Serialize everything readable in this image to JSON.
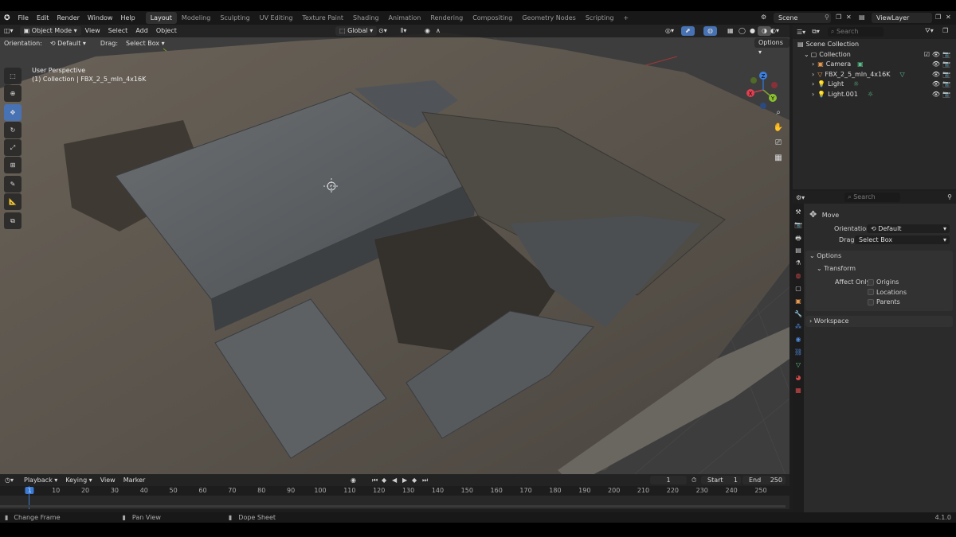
{
  "menu": {
    "items": [
      "File",
      "Edit",
      "Render",
      "Window",
      "Help"
    ]
  },
  "workspaces": [
    "Layout",
    "Modeling",
    "Sculpting",
    "UV Editing",
    "Texture Paint",
    "Shading",
    "Animation",
    "Rendering",
    "Compositing",
    "Geometry Nodes",
    "Scripting"
  ],
  "active_workspace": "Layout",
  "scene": {
    "label": "Scene"
  },
  "view_layer": {
    "label": "ViewLayer"
  },
  "viewport": {
    "mode": "Object Mode",
    "menus": [
      "View",
      "Select",
      "Add",
      "Object"
    ],
    "transform_orientation": "Global",
    "orientation_label": "Orientation:",
    "orientation_value": "Default",
    "drag_label": "Drag:",
    "drag_value": "Select Box",
    "options_label": "Options",
    "perspective": "User Perspective",
    "collection_info": "(1) Collection | FBX_2_5_mln_4x16K",
    "axes": [
      "X",
      "Y",
      "Z"
    ]
  },
  "outliner": {
    "search_placeholder": "Search",
    "root": "Scene Collection",
    "collection": "Collection",
    "items": [
      {
        "name": "Camera",
        "icon": "camera-icon"
      },
      {
        "name": "FBX_2_5_mln_4x16K",
        "icon": "mesh-icon"
      },
      {
        "name": "Light",
        "icon": "light-icon"
      },
      {
        "name": "Light.001",
        "icon": "light-icon"
      }
    ]
  },
  "properties": {
    "search_placeholder": "Search",
    "tool_name": "Move",
    "orientation_label": "Orientation",
    "orientation_value": "Default",
    "drag_label": "Drag:",
    "drag_value": "Select Box",
    "options_panel": "Options",
    "transform_subpanel": "Transform",
    "affect_only_label": "Affect Only",
    "affect_only": [
      "Origins",
      "Locations",
      "Parents"
    ],
    "workspace_panel": "Workspace"
  },
  "timeline": {
    "menus": [
      "Playback",
      "Keying",
      "View",
      "Marker"
    ],
    "current_frame": "1",
    "start_label": "Start",
    "start": "1",
    "end_label": "End",
    "end": "250",
    "ticks": [
      "1",
      "10",
      "20",
      "30",
      "40",
      "50",
      "60",
      "70",
      "80",
      "90",
      "100",
      "110",
      "120",
      "130",
      "140",
      "150",
      "160",
      "170",
      "180",
      "190",
      "200",
      "210",
      "220",
      "230",
      "240",
      "250"
    ]
  },
  "status": {
    "items": [
      "Change Frame",
      "Pan View",
      "Dope Sheet"
    ],
    "version": "4.1.0"
  },
  "colors": {
    "accent": "#4772b3",
    "active_frame": "#3a7bd5"
  }
}
